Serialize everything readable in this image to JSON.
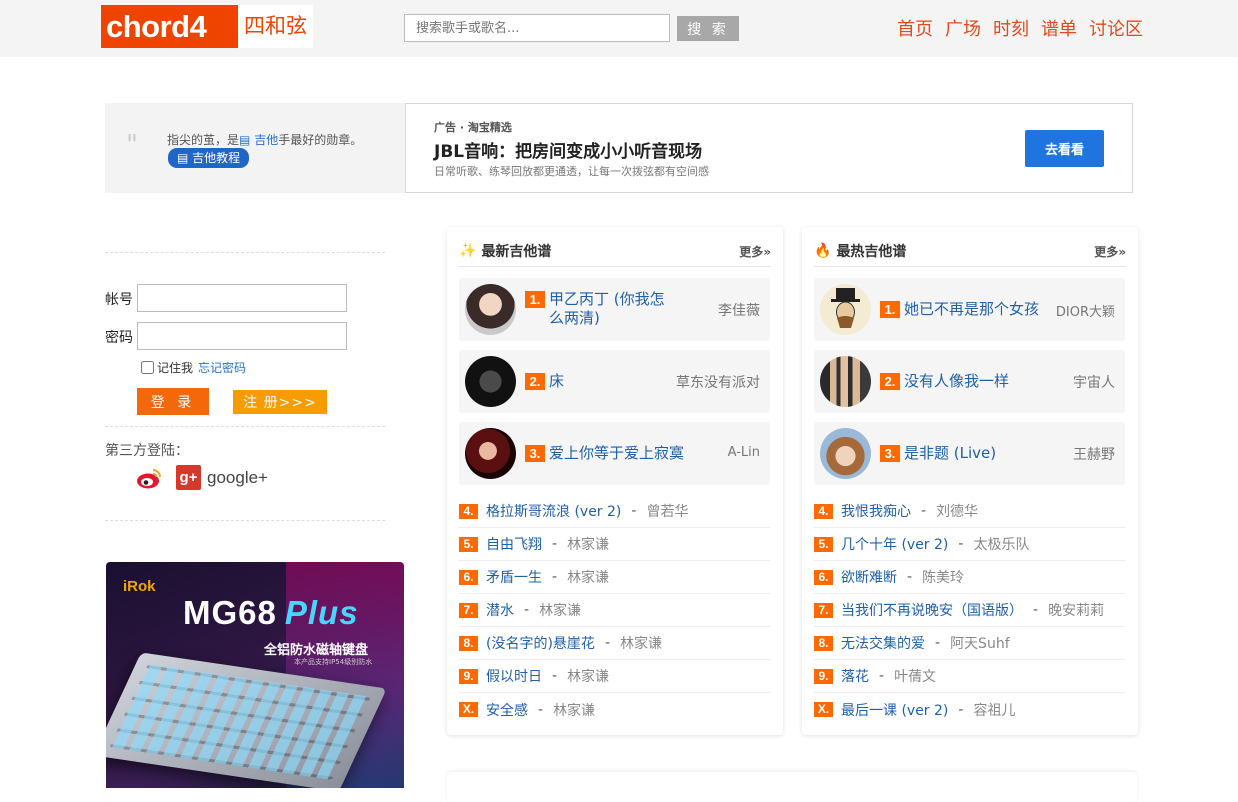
{
  "header": {
    "logo_en": "chord4",
    "logo_cn": "四和弦",
    "search_placeholder": "搜索歌手或歌名...",
    "search_button": "搜 索",
    "nav": [
      "首页",
      "广场",
      "时刻",
      "谱单",
      "讨论区"
    ]
  },
  "banner": {
    "slogan_pre": "指尖的茧，是",
    "slogan_hl": "吉他",
    "slogan_post": "手最好的勋章。",
    "tutorial": "吉他教程",
    "ad_tag": "广告 · 淘宝精选",
    "ad_title": "JBL音响：把房间变成小小听音现场",
    "ad_sub": "日常听歌、练琴回放都更通透，让每一次拨弦都有空间感",
    "ad_button": "去看看"
  },
  "login": {
    "account_label": "帐号",
    "password_label": "密码",
    "remember": "记住我",
    "forgot": "忘记密码",
    "login_button": "登 录",
    "register_button": "注 册>>>",
    "third_party": "第三方登陆：",
    "google": "google+"
  },
  "side_ad": {
    "brand": "iRok",
    "title": "MG68",
    "title_plus": "Plus",
    "subtitle": "全铝防水磁轴键盘",
    "note": "本产品支持IP54级别防水"
  },
  "latest": {
    "title": "最新吉他谱",
    "more": "更多»",
    "top": [
      {
        "rank": "1.",
        "song": "甲乙丙丁 (你我怎么两清)",
        "artist": "李佳薇"
      },
      {
        "rank": "2.",
        "song": "床",
        "artist": "草东没有派对"
      },
      {
        "rank": "3.",
        "song": "爱上你等于爱上寂寞",
        "artist": "A-Lin"
      }
    ],
    "list": [
      {
        "rank": "4.",
        "song": "格拉斯哥流浪 (ver 2)",
        "artist": "曾若华"
      },
      {
        "rank": "5.",
        "song": "自由飞翔",
        "artist": "林家谦"
      },
      {
        "rank": "6.",
        "song": "矛盾一生",
        "artist": "林家谦"
      },
      {
        "rank": "7.",
        "song": "潜水",
        "artist": "林家谦"
      },
      {
        "rank": "8.",
        "song": "(没名字的)悬崖花",
        "artist": "林家谦"
      },
      {
        "rank": "9.",
        "song": "假以时日",
        "artist": "林家谦"
      },
      {
        "rank": "X.",
        "song": "安全感",
        "artist": "林家谦"
      }
    ]
  },
  "hottest": {
    "title": "最热吉他谱",
    "more": "更多»",
    "top": [
      {
        "rank": "1.",
        "song": "她已不再是那个女孩",
        "artist": "DIOR大颖"
      },
      {
        "rank": "2.",
        "song": "没有人像我一样",
        "artist": "宇宙人"
      },
      {
        "rank": "3.",
        "song": "是非题 (Live)",
        "artist": "王赫野"
      }
    ],
    "list": [
      {
        "rank": "4.",
        "song": "我恨我痴心",
        "artist": "刘德华"
      },
      {
        "rank": "5.",
        "song": "几个十年 (ver 2)",
        "artist": "太极乐队"
      },
      {
        "rank": "6.",
        "song": "欲断难断",
        "artist": "陈美玲"
      },
      {
        "rank": "7.",
        "song": "当我们不再说晚安（国语版）",
        "artist": "晚安莉莉"
      },
      {
        "rank": "8.",
        "song": "无法交集的爱",
        "artist": "阿天Suhf"
      },
      {
        "rank": "9.",
        "song": "落花",
        "artist": "叶蒨文"
      },
      {
        "rank": "X.",
        "song": "最后一课 (ver 2)",
        "artist": "容祖儿"
      }
    ]
  },
  "colors": {
    "brand": "#ee4400",
    "nav": "#e4481c",
    "link": "#2060a8",
    "rank": "#ff6a00"
  }
}
